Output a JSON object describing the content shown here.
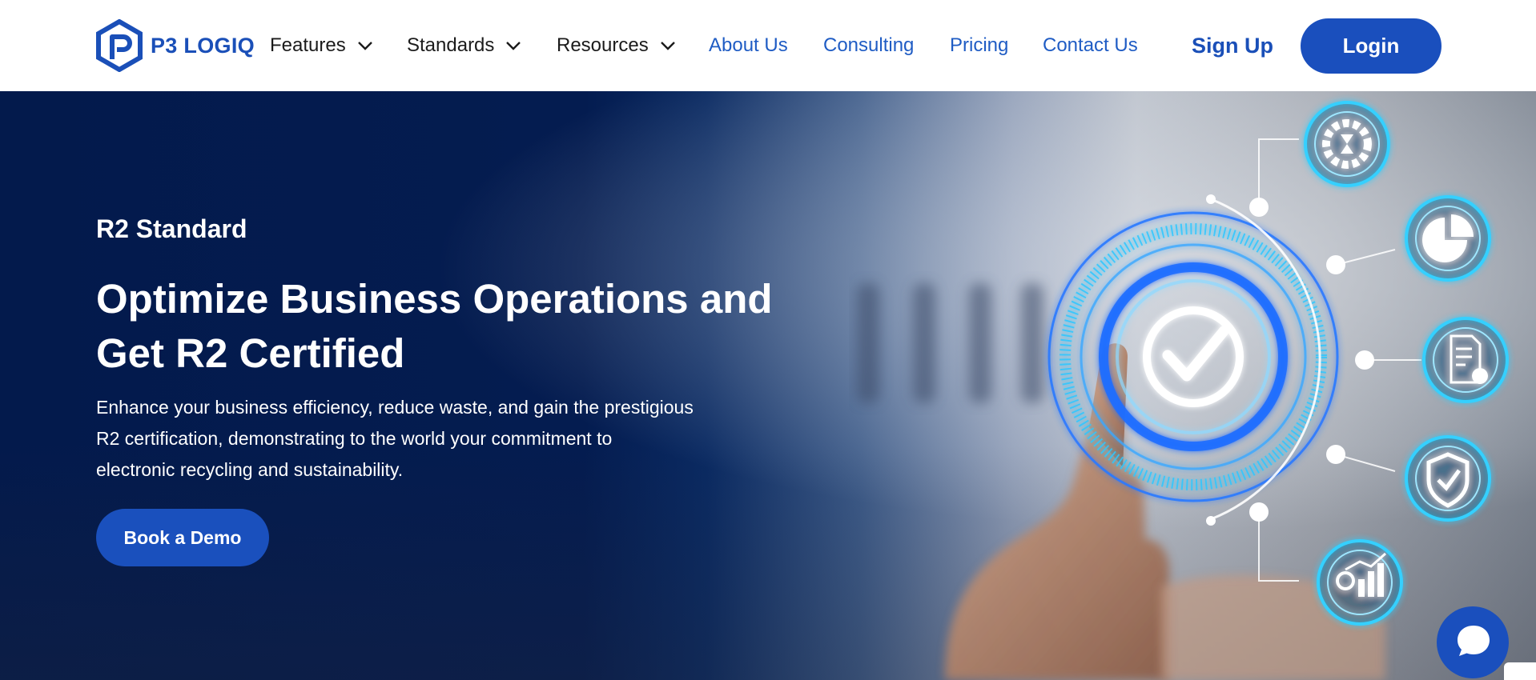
{
  "header": {
    "logo_text": "P3 LOGIQ",
    "nav": [
      {
        "label": "Features",
        "dropdown": true
      },
      {
        "label": "Standards",
        "dropdown": true
      },
      {
        "label": "Resources",
        "dropdown": true
      },
      {
        "label": "About Us",
        "dropdown": false
      },
      {
        "label": "Consulting",
        "dropdown": false
      },
      {
        "label": "Pricing",
        "dropdown": false
      },
      {
        "label": "Contact Us",
        "dropdown": false
      }
    ],
    "signup_label": "Sign Up",
    "login_label": "Login"
  },
  "hero": {
    "eyebrow": "R2 Standard",
    "headline_line1": "Optimize Business Operations and",
    "headline_line2": "Get R2 Certified",
    "desc_line1": "Enhance your business efficiency, reduce waste, and gain the prestigious",
    "desc_line2": "R2 certification, demonstrating to the world your commitment to",
    "desc_line3": "electronic recycling and sustainability.",
    "cta_label": "Book a Demo",
    "icons": [
      "hourglass-gear-icon",
      "pie-chart-icon",
      "document-check-icon",
      "shield-check-icon",
      "growth-chart-icon",
      "checkmark-icon"
    ]
  },
  "chat": {
    "icon": "chat-bubble-icon"
  },
  "colors": {
    "brand": "#1a4fbd",
    "nav_link_blue": "#1f5cc4",
    "hero_navy": "#031a4c",
    "glow_cyan": "#2fc7ff"
  }
}
